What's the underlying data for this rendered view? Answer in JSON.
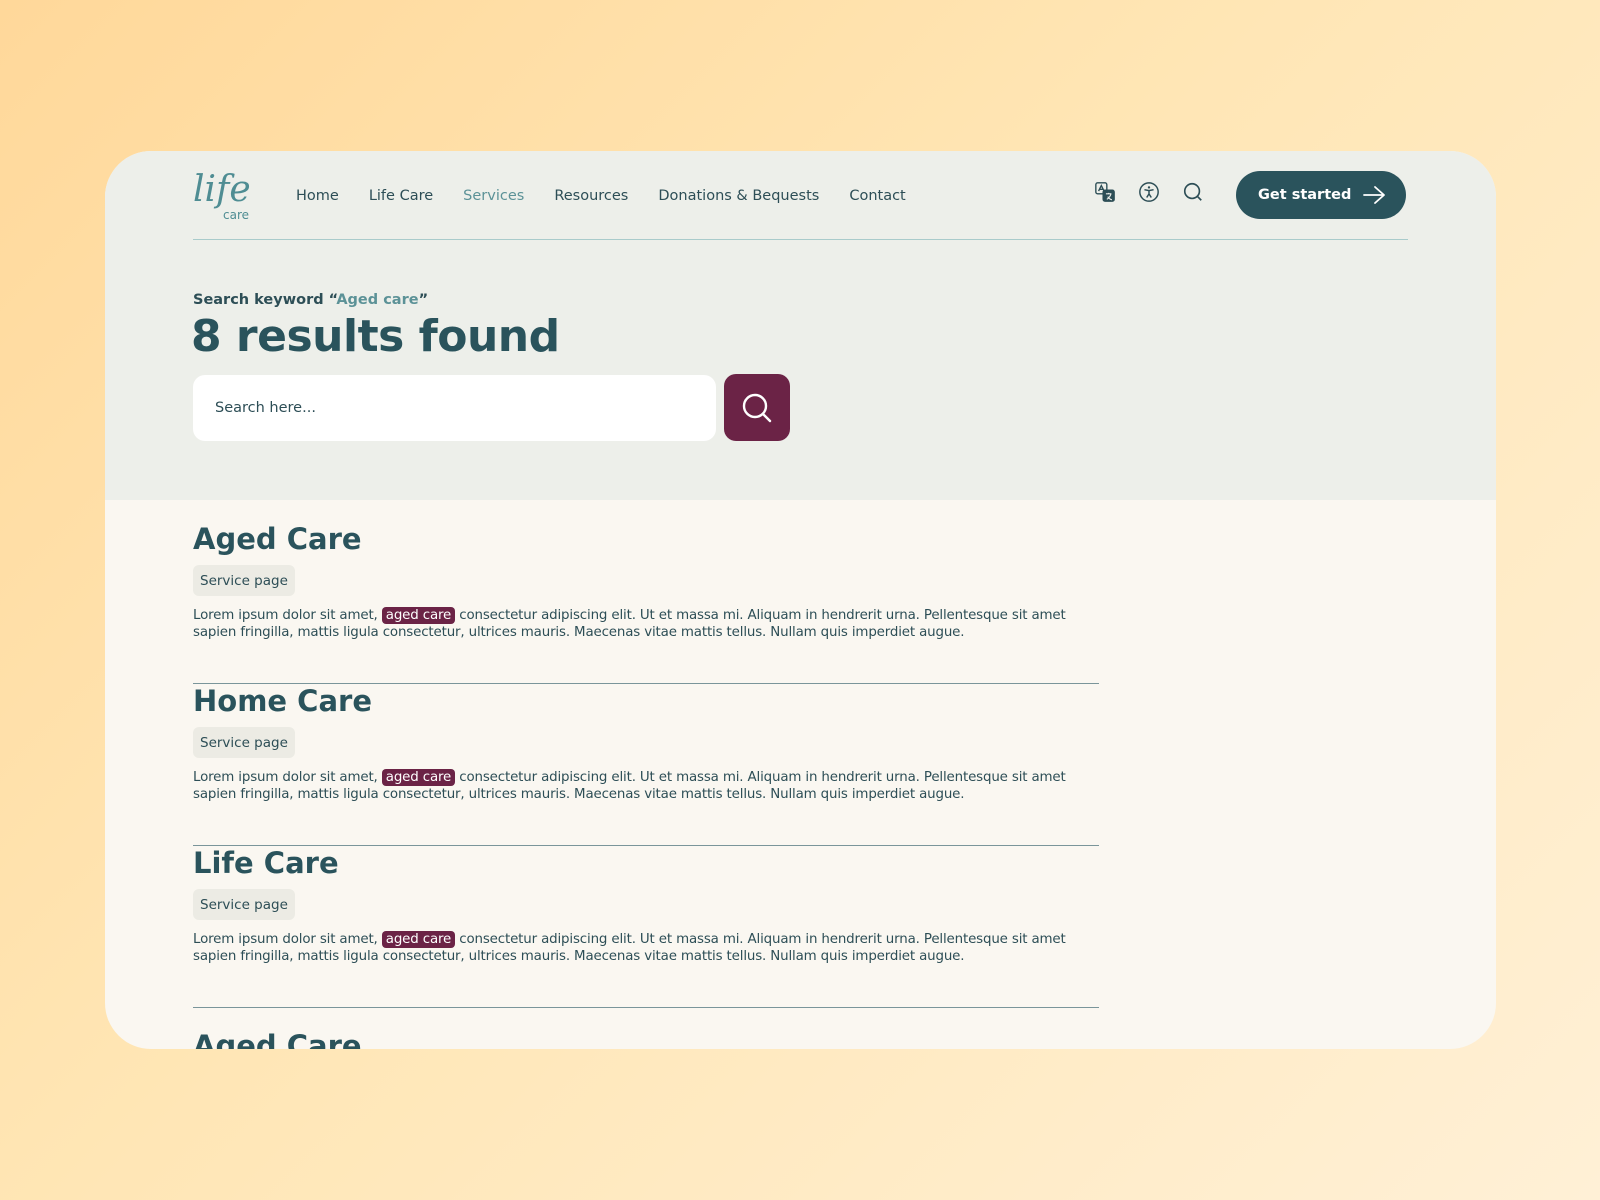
{
  "logo": {
    "main": "life",
    "sub": "care"
  },
  "nav": {
    "items": [
      {
        "label": "Home",
        "active": false
      },
      {
        "label": "Life Care",
        "active": false
      },
      {
        "label": "Services",
        "active": true
      },
      {
        "label": "Resources",
        "active": false
      },
      {
        "label": "Donations & Bequests",
        "active": false
      },
      {
        "label": "Contact",
        "active": false
      }
    ]
  },
  "utility_icons": [
    "translate-icon",
    "accessibility-icon",
    "search-icon"
  ],
  "cta": {
    "label": "Get started",
    "icon": "arrow-right-icon"
  },
  "search": {
    "keyword_prefix": "Search keyword “",
    "keyword": "Aged care",
    "keyword_suffix": "”",
    "results_title": "8 results found",
    "placeholder": "Search here...",
    "button_icon": "search-icon"
  },
  "results": [
    {
      "title": "Aged Care",
      "tag": "Service page",
      "excerpt_before": "Lorem ipsum dolor sit amet, ",
      "highlight": "aged care",
      "excerpt_after": " consectetur adipiscing elit. Ut et massa mi. Aliquam in hendrerit urna. Pellentesque sit amet sapien fringilla, mattis ligula consectetur, ultrices mauris. Maecenas vitae mattis tellus. Nullam quis imperdiet augue."
    },
    {
      "title": "Home Care",
      "tag": "Service page",
      "excerpt_before": "Lorem ipsum dolor sit amet, ",
      "highlight": "aged care",
      "excerpt_after": " consectetur adipiscing elit. Ut et massa mi. Aliquam in hendrerit urna. Pellentesque sit amet sapien fringilla, mattis ligula consectetur, ultrices mauris. Maecenas vitae mattis tellus. Nullam quis imperdiet augue."
    },
    {
      "title": "Life Care",
      "tag": "Service page",
      "excerpt_before": "Lorem ipsum dolor sit amet, ",
      "highlight": "aged care",
      "excerpt_after": " consectetur adipiscing elit. Ut et massa mi. Aliquam in hendrerit urna. Pellentesque sit amet sapien fringilla, mattis ligula consectetur, ultrices mauris. Maecenas vitae mattis tellus. Nullam quis imperdiet augue."
    }
  ],
  "partial_result": {
    "title": "Aged Care"
  },
  "colors": {
    "primary": "#2a535c",
    "accent": "#5c9297",
    "highlight": "#6b2346",
    "hero_bg": "#edefea",
    "body_bg": "#faf7f1"
  }
}
